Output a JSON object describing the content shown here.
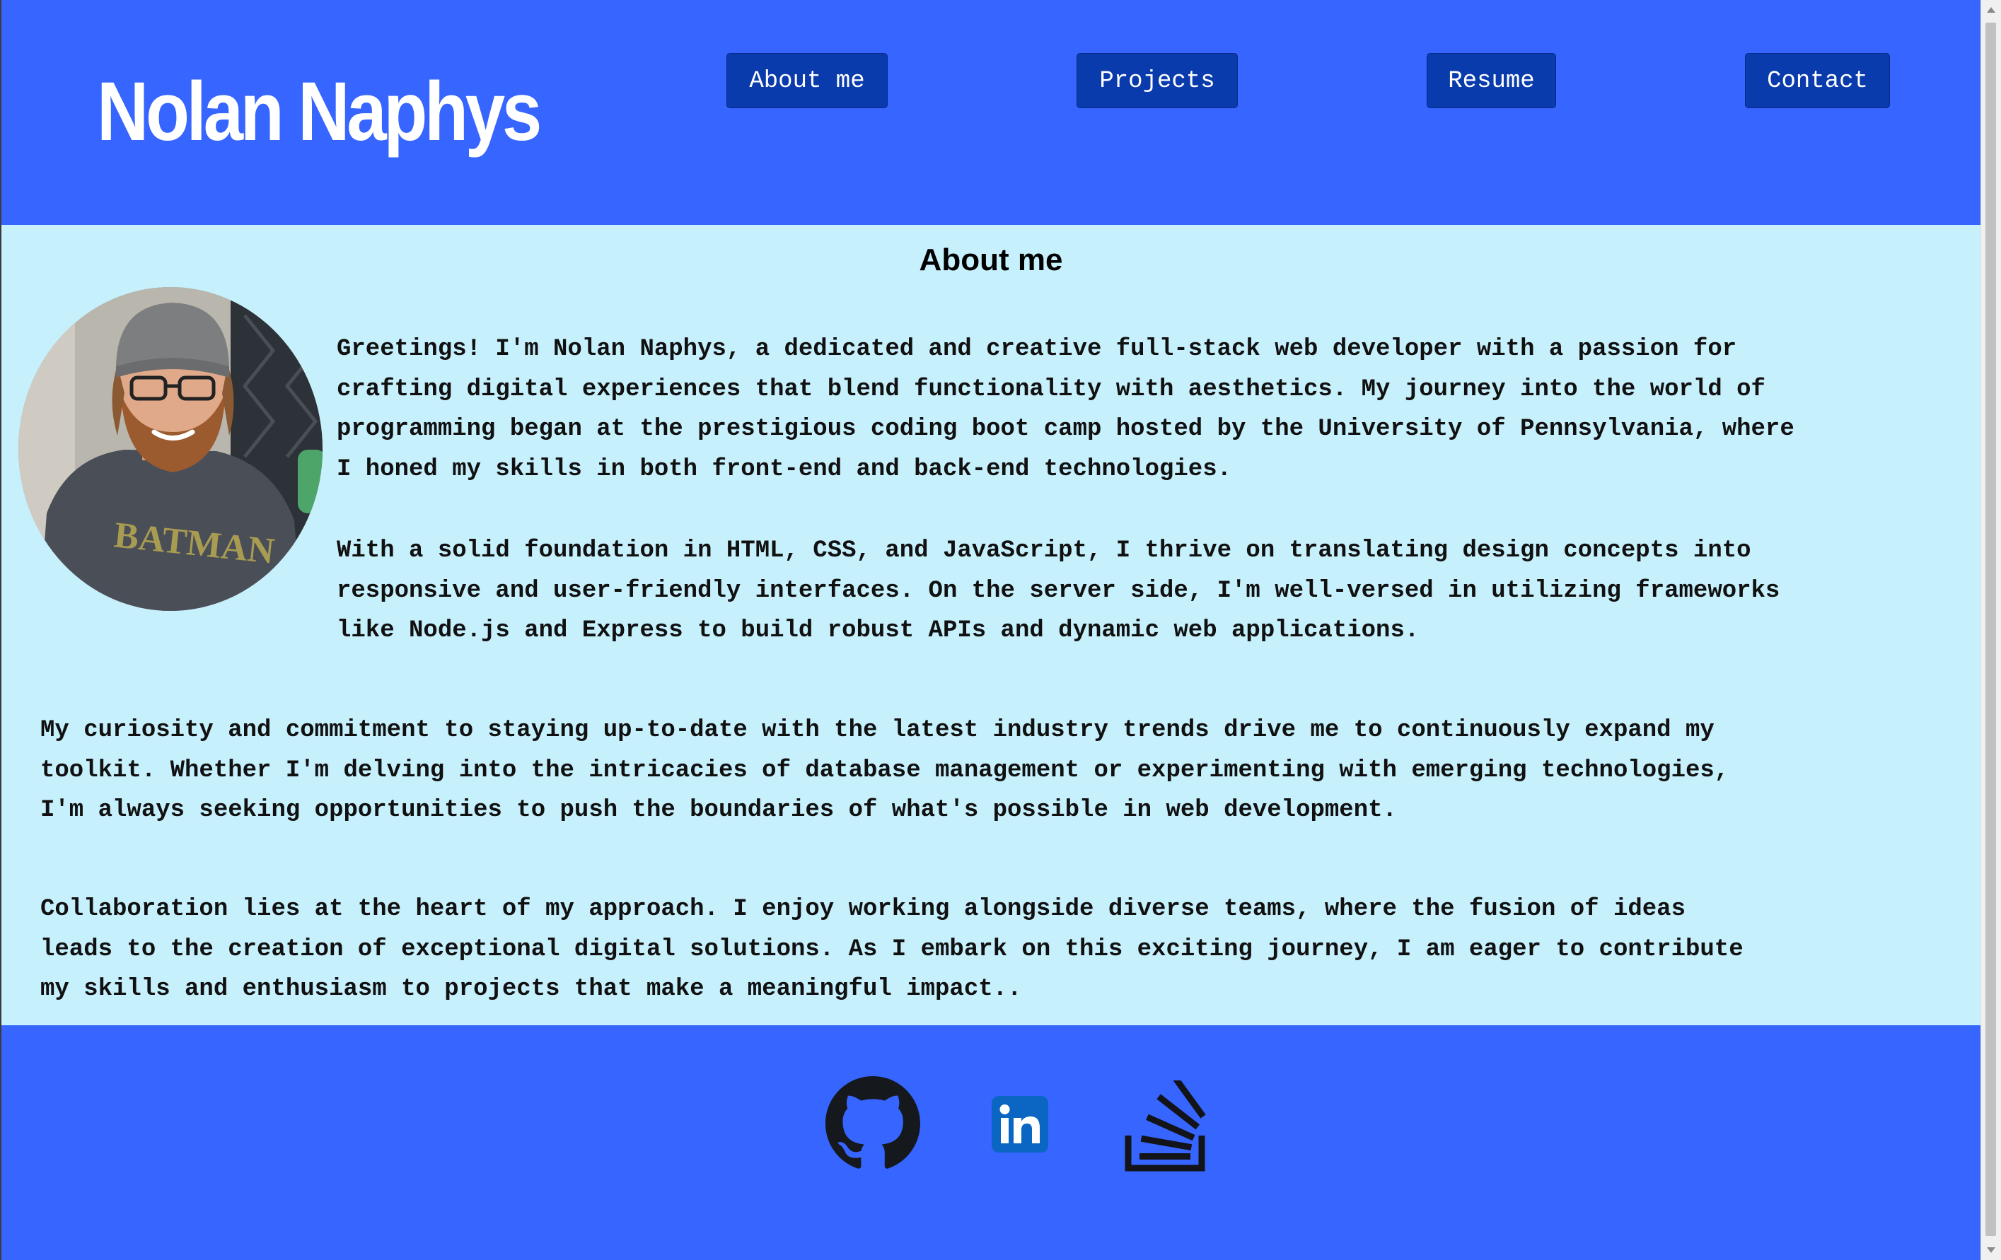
{
  "header": {
    "site_title": "Nolan Naphys",
    "nav": [
      {
        "label": "About me"
      },
      {
        "label": "Projects"
      },
      {
        "label": "Resume"
      },
      {
        "label": "Contact"
      }
    ]
  },
  "about": {
    "title": "About me",
    "photo_icon": "profile-photo",
    "paragraphs": [
      {
        "lines": [
          "Greetings! I'm Nolan Naphys, a dedicated and creative full-stack web developer with a passion for",
          "crafting digital experiences that blend functionality with aesthetics. My journey into the world of",
          "programming began at the prestigious coding boot camp hosted by the University of Pennsylvania, where",
          "I honed my skills in both front-end and back-end technologies."
        ]
      },
      {
        "lines": [
          "With a solid foundation in HTML, CSS, and JavaScript, I thrive on translating design concepts into",
          "responsive and user-friendly interfaces. On the server side, I'm well-versed in utilizing frameworks",
          "like Node.js and Express to build robust APIs and dynamic web applications."
        ]
      },
      {
        "lines": [
          "My curiosity and commitment to staying up-to-date with the latest industry trends drive me to continuously expand my",
          "toolkit. Whether I'm delving into the intricacies of database management or experimenting with emerging technologies,",
          "I'm always seeking opportunities to push the boundaries of what's possible in web development."
        ]
      },
      {
        "lines": [
          "Collaboration lies at the heart of my approach. I enjoy working alongside diverse teams, where the fusion of ideas",
          "leads to the creation of exceptional digital solutions. As I embark on this exciting journey, I am eager to contribute",
          "my skills and enthusiasm to projects that make a meaningful impact.."
        ]
      }
    ]
  },
  "footer": {
    "links": [
      {
        "icon": "github-icon"
      },
      {
        "icon": "linkedin-icon"
      },
      {
        "icon": "stackoverflow-icon"
      }
    ]
  },
  "colors": {
    "header_bg": "#3665ff",
    "nav_button_bg": "#0a3bad",
    "main_bg": "#c7f0fd",
    "footer_bg": "#3665ff",
    "linkedin_blue": "#0a66c2"
  }
}
